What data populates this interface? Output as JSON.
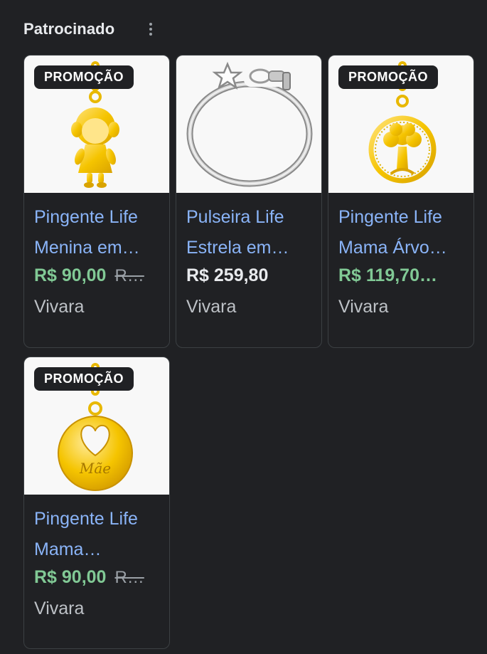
{
  "header": {
    "title": "Patrocinado",
    "more_icon": "more-vert-icon"
  },
  "colors": {
    "link": "#8ab4f8",
    "sale_price": "#81c995",
    "price": "#e8eaed",
    "muted": "#9aa0a6",
    "badge_bg": "#202124"
  },
  "products": [
    {
      "badge": "PROMOÇÃO",
      "title_line1": "Pingente Life",
      "title_line2": "Menina em…",
      "price": "R$ 90,00",
      "old_price": "R…",
      "store": "Vivara",
      "image": "girl-pendant"
    },
    {
      "badge": "",
      "title_line1": "Pulseira Life",
      "title_line2": "Estrela em…",
      "price": "R$ 259,80",
      "old_price": "",
      "store": "Vivara",
      "image": "silver-bracelet"
    },
    {
      "badge": "PROMOÇÃO",
      "title_line1": "Pingente Life",
      "title_line2": "Mama Árvo…",
      "price": "R$ 119,70…",
      "old_price": "",
      "store": "Vivara",
      "image": "tree-pendant"
    },
    {
      "badge": "PROMOÇÃO",
      "title_line1": "Pingente Life",
      "title_line2": "Mama…",
      "price": "R$ 90,00",
      "old_price": "R…",
      "store": "Vivara",
      "image": "mae-heart-pendant",
      "engraving": "Mãe"
    }
  ]
}
